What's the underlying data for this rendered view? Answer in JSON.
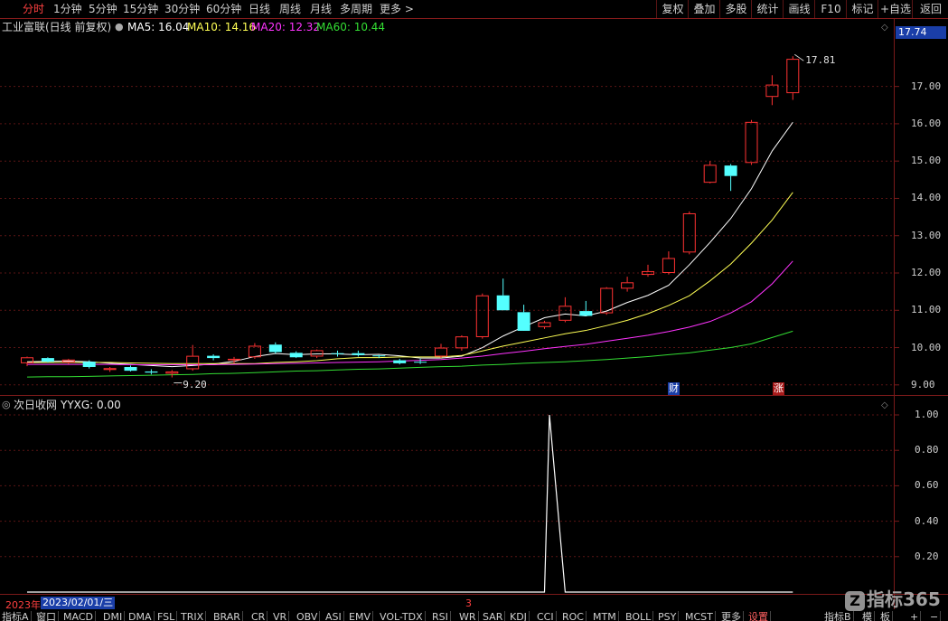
{
  "toolbar": {
    "left": [
      "分时",
      "1分钟",
      "5分钟",
      "15分钟",
      "30分钟",
      "60分钟",
      "日线",
      "周线",
      "月线",
      "多周期",
      "更多 >"
    ],
    "right": [
      "复权",
      "叠加",
      "多股",
      "统计",
      "画线",
      "F10",
      "标记",
      "+自选",
      "返回"
    ]
  },
  "main_info": {
    "stock": "工业富联(日线 前复权)",
    "ma5": "MA5: 16.04",
    "ma10": "MA10: 14.16",
    "ma20": "MA20: 12.32",
    "ma60": "MA60: 10.44"
  },
  "colors": {
    "up": "#ff3232",
    "down": "#54ffff",
    "ma5": "#ffffff",
    "ma10": "#ffff55",
    "ma20": "#ff33ff",
    "ma60": "#33dd33",
    "axis": "#7a1a1a"
  },
  "price_axis": {
    "ticks": [
      "17.00",
      "16.00",
      "15.00",
      "14.00",
      "13.00",
      "12.00",
      "11.00",
      "10.00",
      "9.00"
    ],
    "current": "17.74",
    "high_label": "17.81",
    "low_label": "9.20"
  },
  "chart_data": [
    {
      "type": "candlestick",
      "title": "工业富联(日线 前复权)",
      "ylim": [
        8.85,
        18.3
      ],
      "candles": [
        {
          "o": 9.58,
          "h": 9.76,
          "l": 9.5,
          "c": 9.74
        },
        {
          "o": 9.72,
          "h": 9.74,
          "l": 9.6,
          "c": 9.62
        },
        {
          "o": 9.6,
          "h": 9.7,
          "l": 9.56,
          "c": 9.68
        },
        {
          "o": 9.62,
          "h": 9.66,
          "l": 9.44,
          "c": 9.48
        },
        {
          "o": 9.4,
          "h": 9.48,
          "l": 9.35,
          "c": 9.45
        },
        {
          "o": 9.48,
          "h": 9.52,
          "l": 9.36,
          "c": 9.38
        },
        {
          "o": 9.36,
          "h": 9.42,
          "l": 9.28,
          "c": 9.33
        },
        {
          "o": 9.3,
          "h": 9.4,
          "l": 9.2,
          "c": 9.36
        },
        {
          "o": 9.42,
          "h": 10.07,
          "l": 9.38,
          "c": 9.78
        },
        {
          "o": 9.78,
          "h": 9.82,
          "l": 9.66,
          "c": 9.72
        },
        {
          "o": 9.66,
          "h": 9.75,
          "l": 9.58,
          "c": 9.7
        },
        {
          "o": 9.74,
          "h": 10.12,
          "l": 9.7,
          "c": 10.05
        },
        {
          "o": 10.08,
          "h": 10.14,
          "l": 9.84,
          "c": 9.88
        },
        {
          "o": 9.86,
          "h": 9.9,
          "l": 9.72,
          "c": 9.74
        },
        {
          "o": 9.76,
          "h": 9.95,
          "l": 9.72,
          "c": 9.93
        },
        {
          "o": 9.85,
          "h": 9.92,
          "l": 9.76,
          "c": 9.84
        },
        {
          "o": 9.85,
          "h": 9.92,
          "l": 9.76,
          "c": 9.8
        },
        {
          "o": 9.79,
          "h": 9.8,
          "l": 9.72,
          "c": 9.77
        },
        {
          "o": 9.66,
          "h": 9.7,
          "l": 9.55,
          "c": 9.58
        },
        {
          "o": 9.62,
          "h": 9.7,
          "l": 9.56,
          "c": 9.6
        },
        {
          "o": 9.76,
          "h": 10.1,
          "l": 9.72,
          "c": 10.0
        },
        {
          "o": 9.98,
          "h": 10.33,
          "l": 9.92,
          "c": 10.3
        },
        {
          "o": 10.28,
          "h": 11.45,
          "l": 10.24,
          "c": 11.4
        },
        {
          "o": 11.4,
          "h": 11.85,
          "l": 11.0,
          "c": 11.0
        },
        {
          "o": 10.95,
          "h": 11.15,
          "l": 10.5,
          "c": 10.45
        },
        {
          "o": 10.55,
          "h": 10.72,
          "l": 10.5,
          "c": 10.68
        },
        {
          "o": 10.72,
          "h": 11.35,
          "l": 10.68,
          "c": 11.12
        },
        {
          "o": 10.98,
          "h": 11.25,
          "l": 10.85,
          "c": 10.85
        },
        {
          "o": 10.92,
          "h": 11.62,
          "l": 10.88,
          "c": 11.6
        },
        {
          "o": 11.58,
          "h": 11.9,
          "l": 11.5,
          "c": 11.75
        },
        {
          "o": 11.95,
          "h": 12.22,
          "l": 11.9,
          "c": 12.05
        },
        {
          "o": 12.0,
          "h": 12.58,
          "l": 11.96,
          "c": 12.4
        },
        {
          "o": 12.55,
          "h": 13.65,
          "l": 12.5,
          "c": 13.6
        },
        {
          "o": 14.42,
          "h": 15.0,
          "l": 14.4,
          "c": 14.9
        },
        {
          "o": 14.88,
          "h": 14.92,
          "l": 14.2,
          "c": 14.6
        },
        {
          "o": 14.95,
          "h": 16.1,
          "l": 14.9,
          "c": 16.05
        },
        {
          "o": 16.72,
          "h": 17.3,
          "l": 16.5,
          "c": 17.05
        },
        {
          "o": 16.82,
          "h": 17.81,
          "l": 16.64,
          "c": 17.74
        }
      ],
      "ma_lines": {
        "MA5": [
          9.62,
          9.63,
          9.64,
          9.62,
          9.58,
          9.55,
          9.52,
          9.49,
          9.52,
          9.56,
          9.63,
          9.76,
          9.84,
          9.81,
          9.83,
          9.83,
          9.81,
          9.82,
          9.78,
          9.72,
          9.72,
          9.77,
          10.0,
          10.31,
          10.56,
          10.8,
          10.9,
          10.85,
          10.98,
          11.21,
          11.4,
          11.67,
          12.22,
          12.82,
          13.46,
          14.26,
          15.27,
          16.04
        ],
        "MA10": [
          9.6,
          9.6,
          9.6,
          9.6,
          9.6,
          9.59,
          9.58,
          9.57,
          9.57,
          9.57,
          9.57,
          9.57,
          9.6,
          9.62,
          9.65,
          9.7,
          9.73,
          9.73,
          9.75,
          9.75,
          9.75,
          9.79,
          9.91,
          10.04,
          10.15,
          10.26,
          10.37,
          10.46,
          10.59,
          10.73,
          10.91,
          11.13,
          11.39,
          11.79,
          12.24,
          12.8,
          13.42,
          14.16
        ],
        "MA20": [
          9.55,
          9.55,
          9.55,
          9.55,
          9.55,
          9.54,
          9.54,
          9.54,
          9.54,
          9.54,
          9.55,
          9.56,
          9.57,
          9.58,
          9.59,
          9.6,
          9.61,
          9.62,
          9.64,
          9.66,
          9.68,
          9.72,
          9.77,
          9.84,
          9.9,
          9.97,
          10.03,
          10.09,
          10.17,
          10.25,
          10.33,
          10.43,
          10.55,
          10.7,
          10.93,
          11.23,
          11.71,
          12.32
        ],
        "MA60": [
          9.21,
          9.22,
          9.22,
          9.23,
          9.24,
          9.25,
          9.26,
          9.27,
          9.28,
          9.3,
          9.31,
          9.33,
          9.35,
          9.37,
          9.38,
          9.4,
          9.42,
          9.43,
          9.45,
          9.47,
          9.49,
          9.5,
          9.53,
          9.55,
          9.58,
          9.6,
          9.62,
          9.65,
          9.68,
          9.72,
          9.76,
          9.81,
          9.86,
          9.93,
          10.0,
          10.1,
          10.27,
          10.44
        ]
      }
    },
    {
      "type": "line",
      "title": "次日收网",
      "series": [
        {
          "name": "YYXG",
          "values": [
            0,
            0,
            0,
            0,
            0,
            0,
            0,
            0,
            0,
            0,
            0,
            0,
            0,
            0,
            0,
            0,
            0,
            0,
            0,
            0,
            0,
            0,
            0,
            0,
            1,
            0,
            0,
            0,
            0,
            0,
            0,
            0,
            0,
            0,
            0,
            0,
            0,
            0
          ]
        }
      ],
      "ylim": [
        0,
        1.0
      ],
      "yticks": [
        "1.00",
        "0.80",
        "0.60",
        "0.40",
        "0.20"
      ]
    }
  ],
  "sub_info": {
    "name": "次日收网",
    "value": "YYXG: 0.00"
  },
  "markers": {
    "cai": "财",
    "zhang": "涨"
  },
  "datebar": {
    "year": "2023年",
    "date": "2023/02/01/三",
    "month": "3"
  },
  "bottom_tabs": [
    "指标A",
    "窗口",
    "MACD",
    "DMI",
    "DMA",
    "FSL",
    "TRIX",
    "BRAR",
    "CR",
    "VR",
    "OBV",
    "ASI",
    "EMV",
    "VOL-TDX",
    "RSI",
    "WR",
    "SAR",
    "KDJ",
    "CCI",
    "ROC",
    "MTM",
    "BOLL",
    "PSY",
    "MCST",
    "更多",
    "设置"
  ],
  "bottom_right": [
    "指标B",
    "模",
    "板"
  ],
  "watermark": {
    "text": "指标365"
  }
}
